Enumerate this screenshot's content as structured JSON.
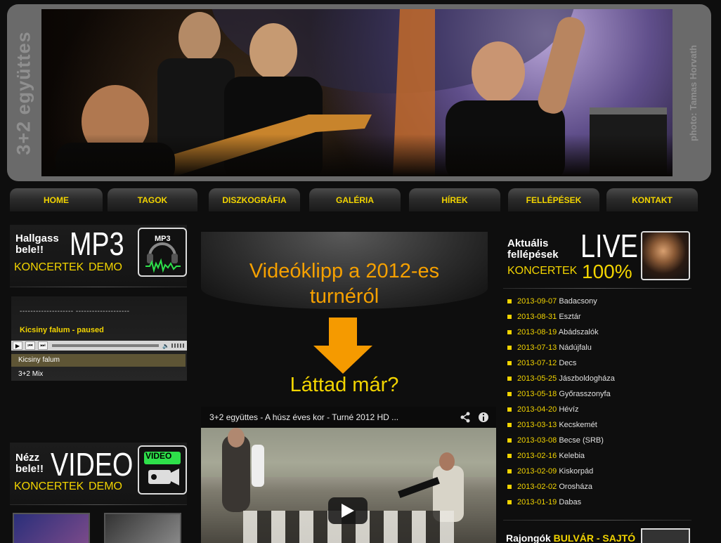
{
  "header": {
    "band_name": "3+2 együttes",
    "photo_credit": "photo: Tamas Horvath"
  },
  "nav": [
    {
      "label": "HOME"
    },
    {
      "label": "TAGOK"
    },
    {
      "label": "DISZKOGRÁFIA"
    },
    {
      "label": "GALÉRIA"
    },
    {
      "label": "HÍREK"
    },
    {
      "label": "FELLÉPÉSEK"
    },
    {
      "label": "KONTAKT"
    }
  ],
  "mp3_promo": {
    "line1": "Hallgass",
    "line2": "bele!!",
    "big": "MP3",
    "link1": "KONCERTEK",
    "link2": "DEMO",
    "icon_label": "MP3",
    "icon": "headphones-icon"
  },
  "player": {
    "dashes": "--------------------   --------------------",
    "status": "Kicsiny falum - paused",
    "playlist": [
      "Kicsiny falum",
      "3+2 Mix"
    ],
    "controls": [
      "play-icon",
      "prev-icon",
      "next-icon",
      "volume-icon"
    ]
  },
  "video_promo": {
    "line1": "Nézz",
    "line2": "bele!!",
    "big": "VIDEO",
    "link1": "KONCERTEK",
    "link2": "DEMO",
    "icon_label": "VIDEO",
    "icon": "camera-icon"
  },
  "middle": {
    "title_line1": "Videóklipp a 2012-es",
    "title_line2": "turnéról",
    "seen": "Láttad már?",
    "video_title": "3+2 együttes - A húsz éves kor - Turné 2012 HD ...",
    "video_icons": [
      "share-icon",
      "info-icon",
      "play-icon"
    ]
  },
  "live_promo": {
    "line1": "Aktuális",
    "line2": "fellépések",
    "big": "LIVE",
    "link": "KONCERTEK",
    "percent": "100%"
  },
  "gigs": [
    {
      "date": "2013-09-07",
      "place": "Badacsony"
    },
    {
      "date": "2013-08-31",
      "place": "Esztár"
    },
    {
      "date": "2013-08-19",
      "place": "Abádszalók"
    },
    {
      "date": "2013-07-13",
      "place": "Nádújfalu"
    },
    {
      "date": "2013-07-12",
      "place": "Decs"
    },
    {
      "date": "2013-05-25",
      "place": "Jászboldogháza"
    },
    {
      "date": "2013-05-18",
      "place": "Győrasszonyfa"
    },
    {
      "date": "2013-04-20",
      "place": "Hévíz"
    },
    {
      "date": "2013-03-13",
      "place": "Kecskemét"
    },
    {
      "date": "2013-03-08",
      "place": "Becse (SRB)"
    },
    {
      "date": "2013-02-16",
      "place": "Kelebia"
    },
    {
      "date": "2013-02-09",
      "place": "Kiskorpád"
    },
    {
      "date": "2013-02-02",
      "place": "Orosháza"
    },
    {
      "date": "2013-01-19",
      "place": "Dabas"
    }
  ],
  "fans": {
    "label": "Rajongók",
    "links": "BULVÁR - SAJTÓ"
  },
  "colors": {
    "accent_yellow": "#f2d400",
    "accent_orange": "#f5a000",
    "background": "#0e0e0e"
  }
}
